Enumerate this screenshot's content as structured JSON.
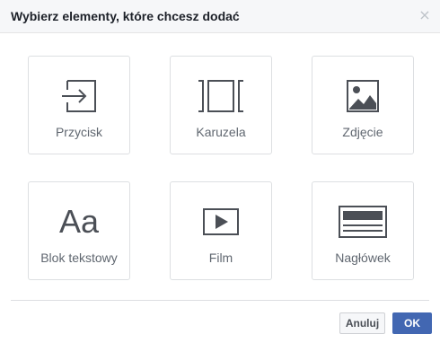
{
  "dialog": {
    "title": "Wybierz elementy, które chcesz dodać",
    "close_icon": "×"
  },
  "tiles": [
    {
      "label": "Przycisk",
      "icon": "button-enter-icon"
    },
    {
      "label": "Karuzela",
      "icon": "carousel-icon"
    },
    {
      "label": "Zdjęcie",
      "icon": "image-icon"
    },
    {
      "label": "Blok tekstowy",
      "icon": "text-block-icon",
      "icon_text": "Aa"
    },
    {
      "label": "Film",
      "icon": "video-icon"
    },
    {
      "label": "Nagłówek",
      "icon": "header-icon"
    }
  ],
  "footer": {
    "cancel_label": "Anuluj",
    "ok_label": "OK"
  },
  "colors": {
    "accent": "#4267b2",
    "icon": "#4b4f56",
    "label": "#606770",
    "border": "#dddfe2"
  }
}
